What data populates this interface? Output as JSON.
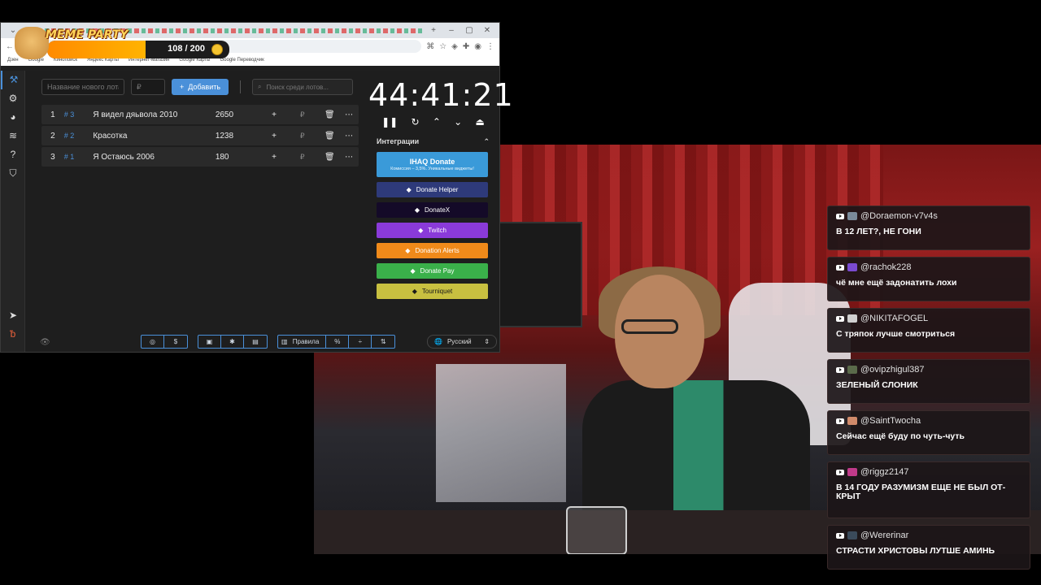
{
  "overlay": {
    "title": "MEME PARTY",
    "count": "108 / 200",
    "progress": 0.54
  },
  "browser": {
    "bookmarks": [
      "Дзен",
      "Google",
      "Кинопоиск",
      "Яндекс Карты",
      "Интернет-магазин",
      "Google Карты",
      "Google Переводчик"
    ]
  },
  "toolbar": {
    "new_lot_placeholder": "Название нового лота",
    "amount_placeholder": "₽",
    "add_label": "Добавить",
    "search_placeholder": "Поиск среди лотов..."
  },
  "lots": [
    {
      "num": "1",
      "tag": "# 3",
      "name": "Я видел дяьвола 2010",
      "amount": "2650",
      "plus": "+",
      "rub": "₽"
    },
    {
      "num": "2",
      "tag": "# 2",
      "name": "Красотка",
      "amount": "1238",
      "plus": "+",
      "rub": "₽"
    },
    {
      "num": "3",
      "tag": "# 1",
      "name": "Я Остаюсь 2006",
      "amount": "180",
      "plus": "+",
      "rub": "₽"
    }
  ],
  "timer": "44:41:21",
  "integrations": {
    "header": "Интеграции",
    "main": {
      "title": "IHAQ Donate",
      "subtitle": "Комиссия – 3,5%. Уникальные виджеты!",
      "color": "#3a9ad9"
    },
    "items": [
      {
        "label": "Donate Helper",
        "color": "#2e3a7a"
      },
      {
        "label": "DonateX",
        "color": "#140a28"
      },
      {
        "label": "Twitch",
        "color": "#8a3ad9"
      },
      {
        "label": "Donation Alerts",
        "color": "#f08a1a"
      },
      {
        "label": "Donate Pay",
        "color": "#3ab04a"
      },
      {
        "label": "Tourniquet",
        "color": "#c8c040"
      }
    ]
  },
  "footer": {
    "rules": "Правила",
    "language": "Русский"
  },
  "chat": [
    {
      "user": "@Doraemon-v7v4s",
      "avatar": "#7a8a9a",
      "text": "В 12 ЛЕТ?, НЕ ГОНИ"
    },
    {
      "user": "@rachok228",
      "avatar": "#7a4ad0",
      "text": "чё мне ещё задонатить лохи"
    },
    {
      "user": "@NIKITAFOGEL",
      "avatar": "#cfcfcf",
      "text": "С тряпок лучше смотриться"
    },
    {
      "user": "@ovipzhigul387",
      "avatar": "#5a6a4a",
      "text": "ЗЕЛЕНЫЙ СЛОНИК"
    },
    {
      "user": "@SaintTwocha",
      "avatar": "#d08a6a",
      "text": "Сейчас ещё буду по чуть-чуть"
    },
    {
      "user": "@riggz2147",
      "avatar": "#c03a8a",
      "text": "В 14 ГОДУ РАЗУМИЗМ ЕЩЕ НЕ БЫЛ ОТ-КРЫТ"
    },
    {
      "user": "@Wererinar",
      "avatar": "#3a4a5a",
      "text": "СТРАСТИ ХРИСТОВЫ ЛУТШЕ АМИНЬ"
    }
  ]
}
